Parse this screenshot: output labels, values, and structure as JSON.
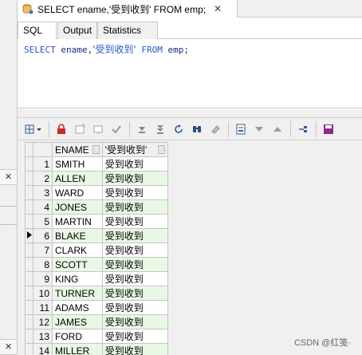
{
  "window_tab": {
    "title": "SELECT ename,'受到收到' FROM emp;",
    "close": "✕"
  },
  "subtabs": [
    {
      "label": "SQL"
    },
    {
      "label": "Output"
    },
    {
      "label": "Statistics"
    }
  ],
  "editor": {
    "kw_select": "SELECT",
    "cols": " ename,",
    "str": "'受到收到'",
    "kw_from": "FROM",
    "table": " emp;"
  },
  "left_panel": {
    "close_1": "✕",
    "close_2": "✕"
  },
  "grid": {
    "headers": [
      "ENAME",
      "'受到收到'"
    ],
    "current_row": 6,
    "rows": [
      {
        "num": "1",
        "ename": "SMITH",
        "val": "受到收到"
      },
      {
        "num": "2",
        "ename": "ALLEN",
        "val": "受到收到"
      },
      {
        "num": "3",
        "ename": "WARD",
        "val": "受到收到"
      },
      {
        "num": "4",
        "ename": "JONES",
        "val": "受到收到"
      },
      {
        "num": "5",
        "ename": "MARTIN",
        "val": "受到收到"
      },
      {
        "num": "6",
        "ename": "BLAKE",
        "val": "受到收到"
      },
      {
        "num": "7",
        "ename": "CLARK",
        "val": "受到收到"
      },
      {
        "num": "8",
        "ename": "SCOTT",
        "val": "受到收到"
      },
      {
        "num": "9",
        "ename": "KING",
        "val": "受到收到"
      },
      {
        "num": "10",
        "ename": "TURNER",
        "val": "受到收到"
      },
      {
        "num": "11",
        "ename": "ADAMS",
        "val": "受到收到"
      },
      {
        "num": "12",
        "ename": "JAMES",
        "val": "受到收到"
      },
      {
        "num": "13",
        "ename": "FORD",
        "val": "受到收到"
      },
      {
        "num": "14",
        "ename": "MILLER",
        "val": "受到收到"
      }
    ]
  },
  "toolbar_icons": [
    "grid-options-icon",
    "lock-icon",
    "new-record-icon",
    "clear-record-icon",
    "post-record-icon",
    "fetch-next-icon",
    "fetch-last-icon",
    "refresh-icon",
    "find-icon",
    "clear-icon",
    "export-icon",
    "filter-down-icon",
    "filter-up-icon",
    "connect-icon",
    "save-icon"
  ],
  "watermark": "CSDN @红笺·"
}
